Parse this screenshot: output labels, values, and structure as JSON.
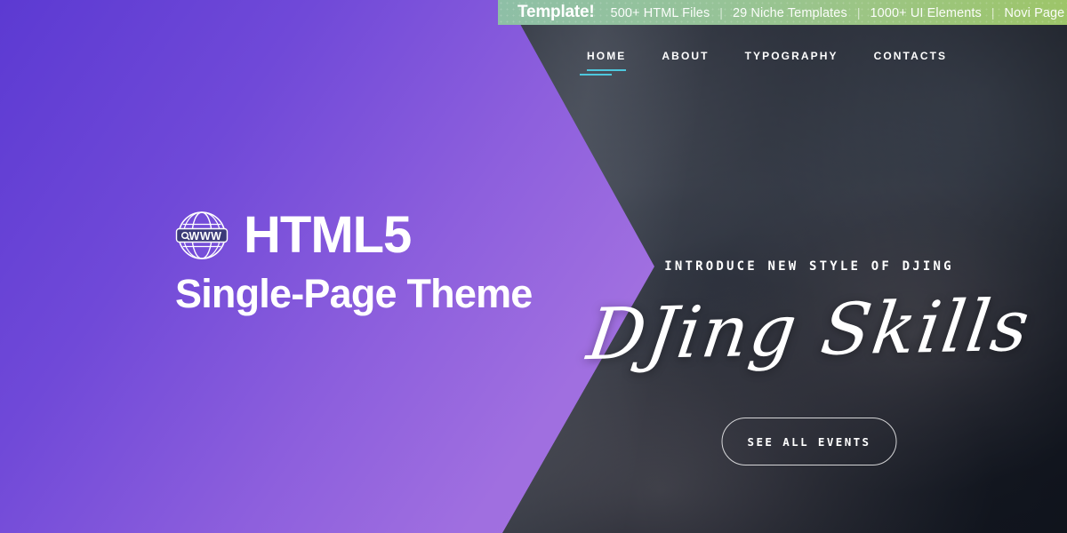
{
  "promo": {
    "brand": "Template!",
    "features": [
      "500+ HTML Files",
      "29 Niche Templates",
      "1000+ UI Elements",
      "Novi Page Build"
    ],
    "separator": "|",
    "colors": {
      "gradient_start": "#8ebfa6",
      "gradient_end": "#9dc569",
      "text": "#ffffff"
    }
  },
  "nav": {
    "items": [
      {
        "label": "HOME",
        "active": true
      },
      {
        "label": "ABOUT",
        "active": false
      },
      {
        "label": "TYPOGRAPHY",
        "active": false
      },
      {
        "label": "CONTACTS",
        "active": false
      }
    ],
    "active_underline_color": "#4ec8dd"
  },
  "left_panel": {
    "logo_icon": "globe-www-icon",
    "logo_badge_text": "WWW",
    "title": "HTML5",
    "subtitle": "Single-Page Theme",
    "colors": {
      "gradient_start": "#5c3ad2",
      "gradient_end": "#a471e2",
      "text": "#ffffff"
    }
  },
  "hero": {
    "kicker": "INTRODUCE NEW STYLE OF DJING",
    "heading": "DJing Skills",
    "button_label": "SEE ALL EVENTS",
    "background": "dj-hands-on-mixer-photo",
    "overlay_color": "#1e2430"
  }
}
